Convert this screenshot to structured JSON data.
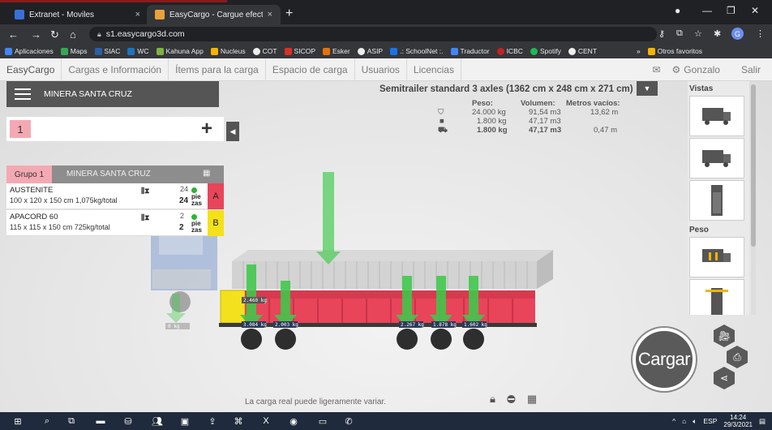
{
  "browser": {
    "tabs": [
      {
        "title": "Extranet - Moviles",
        "close": "×"
      },
      {
        "title": "EasyCargo - Cargue efectivamente",
        "close": "×"
      }
    ],
    "new_tab": "+",
    "url": "s1.easycargo3d.com",
    "bookmarks": [
      "Aplicaciones",
      "Maps",
      "SIAC",
      "WC",
      "Kahuna App",
      "Nucleus",
      "COT",
      "SICOP",
      "Esker",
      "ASIP",
      ".: SchoolNet :.",
      "Traductor",
      "ICBC",
      "Spotify",
      "CENT"
    ],
    "bookmarks_more": "»",
    "other_bookmarks": "Otros favoritos",
    "profile_initial": "G"
  },
  "app": {
    "menu": [
      "EasyCargo",
      "Cargas e Información",
      "Ítems para la carga",
      "Espacio de carga",
      "Usuarios",
      "Licencias"
    ],
    "user": "Gonzalo",
    "logout": "Salir",
    "client_name": "MINERA SANTA CRUZ",
    "group_number": "1",
    "group": {
      "label": "Grupo 1",
      "client": "MINERA SANTA CRUZ"
    },
    "items": [
      {
        "name": "AUSTENITE",
        "dims": "100 x 120 x 150 cm 1,075kg/total",
        "qty_top": "24",
        "qty": "24",
        "unit": "pie\nzas",
        "tag": "A",
        "tag_color": "#e8455a"
      },
      {
        "name": "APACORD 60",
        "dims": "115 x 115 x 150 cm 725kg/total",
        "qty_top": "2",
        "qty": "2",
        "unit": "pie\nzas",
        "tag": "B",
        "tag_color": "#f4e11a"
      }
    ],
    "truck": {
      "title": "Semitrailer standard 3 axles (1362 cm x 248 cm x 271 cm)",
      "headers": {
        "weight": "Peso:",
        "volume": "Volumen:",
        "empty": "Metros vacíos:"
      },
      "rows": [
        {
          "weight": "24.000 kg",
          "volume": "91,54 m3",
          "empty": "13,62 m"
        },
        {
          "weight": "1.800 kg",
          "volume": "47,17 m3",
          "empty": ""
        },
        {
          "weight": "1.800 kg",
          "volume": "47,17 m3",
          "empty": "0,47 m"
        }
      ]
    },
    "side_panel": {
      "views_title": "Vistas",
      "weight_title": "Peso"
    },
    "axle_labels": [
      "0 kg",
      "2.460 kg",
      "3.084 kg",
      "2.003 kg",
      "2.267 kg",
      "1.878 kg",
      "1.602 kg"
    ],
    "cargar_label": "Cargar",
    "note": "La carga real puede ligeramente variar."
  },
  "taskbar": {
    "lang": "ESP",
    "time": "14:24",
    "date": "29/3/2021"
  },
  "colors": {
    "pink": "#f4a9b2",
    "cargo_red": "#e8455a",
    "arrow_green": "#3ec94a",
    "dark_header": "#555555"
  }
}
